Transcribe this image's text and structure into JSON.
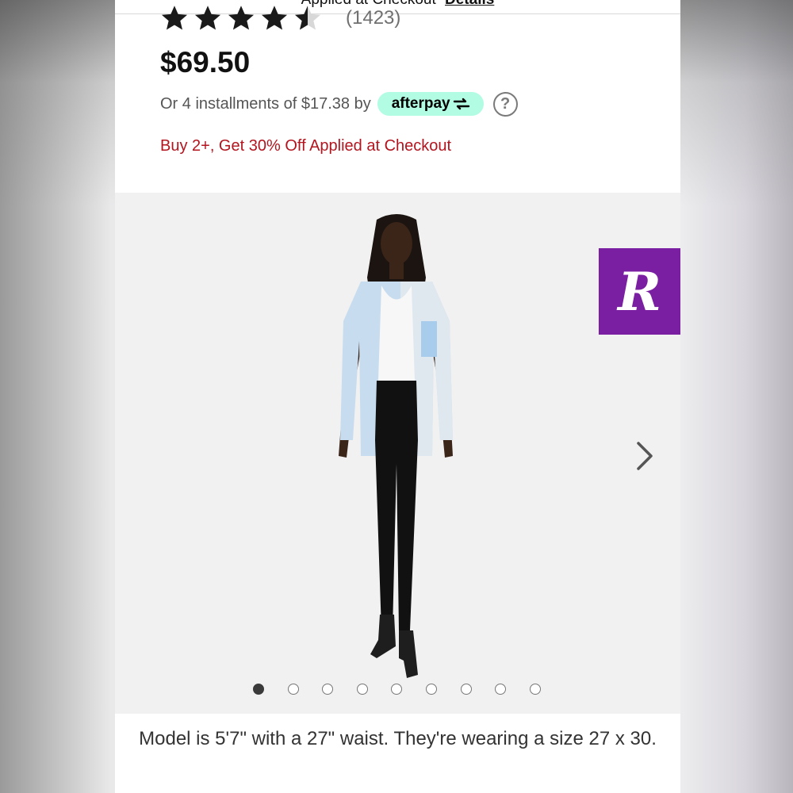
{
  "header": {
    "cutoff_text": "Applied at Checkout",
    "cutoff_link": "Details"
  },
  "rating": {
    "stars": 4.5,
    "max_stars": 5,
    "review_count": "(1423)"
  },
  "price": "$69.50",
  "installments": {
    "text": "Or 4 installments of $17.38 by",
    "provider": "afterpay",
    "help_icon": "?"
  },
  "promo": "Buy 2+, Get 30% Off Applied at Checkout",
  "gallery": {
    "image_alt": "model-photo",
    "total_images": 9,
    "active_index": 0,
    "next_icon": "chevron-right-icon"
  },
  "caption": "Model is 5'7\" with a 27\" waist. They're wearing a size 27 x 30.",
  "badge": {
    "letter": "R",
    "color": "#7b1fa2"
  },
  "colors": {
    "promo": "#b3151f",
    "afterpay_bg": "#b2fce4"
  }
}
